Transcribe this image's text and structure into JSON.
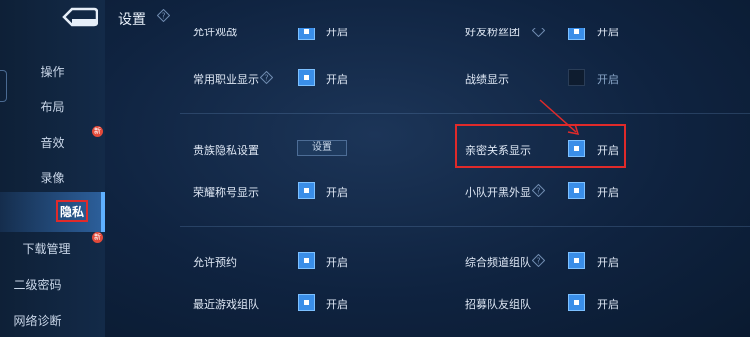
{
  "header": {
    "title": "设置"
  },
  "sidebar": {
    "items": [
      {
        "label": "操作",
        "badge": ""
      },
      {
        "label": "布局",
        "badge": ""
      },
      {
        "label": "音效",
        "badge": "新"
      },
      {
        "label": "录像",
        "badge": ""
      },
      {
        "label": "隐私",
        "badge": ""
      },
      {
        "label": "下载管理",
        "badge": "新"
      },
      {
        "label": "二级密码",
        "badge": ""
      },
      {
        "label": "网络诊断",
        "badge": ""
      }
    ],
    "active": "隐私"
  },
  "settings": {
    "left": [
      {
        "label": "允许观战",
        "state": "开启",
        "checked": true
      },
      {
        "label": "常用职业显示",
        "state": "开启",
        "checked": true
      },
      {
        "label": "贵族隐私设置",
        "button": "设置"
      },
      {
        "label": "荣耀称号显示",
        "state": "开启",
        "checked": true
      },
      {
        "label": "允许预约",
        "state": "开启",
        "checked": true
      },
      {
        "label": "最近游戏组队",
        "state": "开启",
        "checked": true
      }
    ],
    "right": [
      {
        "label": "好友粉丝团",
        "state": "开启",
        "checked": true
      },
      {
        "label": "战绩显示",
        "state": "开启",
        "checked": false
      },
      {
        "label": "亲密关系显示",
        "state": "开启",
        "checked": true
      },
      {
        "label": "小队开黑外显",
        "state": "开启",
        "checked": true
      },
      {
        "label": "综合频道组队",
        "state": "开启",
        "checked": true
      },
      {
        "label": "招募队友组队",
        "state": "开启",
        "checked": true
      }
    ]
  },
  "colors": {
    "accent": "#3a8ee8",
    "highlight": "#e02a2a",
    "background": "#0f2340"
  }
}
